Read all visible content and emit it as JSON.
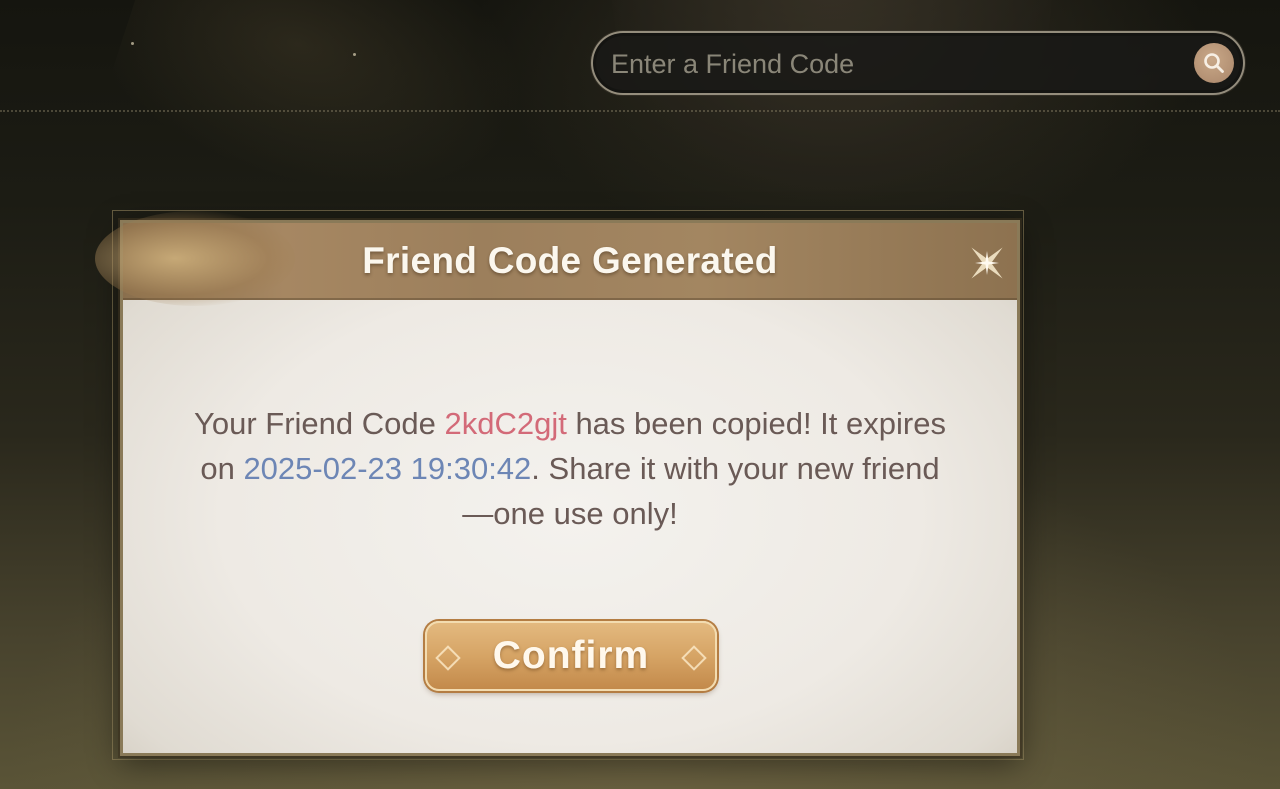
{
  "search": {
    "placeholder": "Enter a Friend Code",
    "icon": "search-icon"
  },
  "dialog": {
    "title": "Friend Code Generated",
    "close_icon": "close-star-icon",
    "message": {
      "part1": "Your Friend Code ",
      "friend_code": "2kdC2gjt",
      "part2": " has been copied! It expires on ",
      "expiry": "2025-02-23 19:30:42",
      "part3": ". Share it with your new friend—one use only!"
    },
    "confirm_label": "Confirm"
  },
  "colors": {
    "friend_code": "#d36a78",
    "expiry_date": "#6d86b5",
    "body_text": "#6a5a56",
    "confirm_button": "#d6a465",
    "header_bar": "#9c7f5c"
  }
}
